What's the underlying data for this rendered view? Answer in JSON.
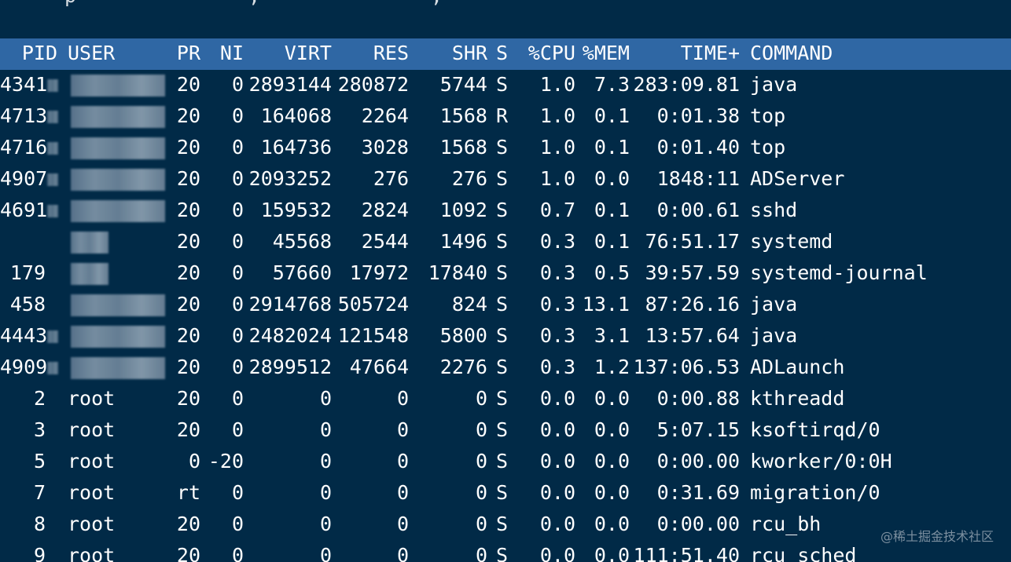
{
  "top_fragments": [
    {
      "text": "p"
    },
    {
      "text": ","
    },
    {
      "text": ","
    }
  ],
  "header": {
    "pid": "PID",
    "user": "USER",
    "pr": "PR",
    "ni": "NI",
    "virt": "VIRT",
    "res": "RES",
    "shr": "SHR",
    "s": "S",
    "cpu": "%CPU",
    "mem": "%MEM",
    "time": "TIME+",
    "command": "COMMAND"
  },
  "processes": [
    {
      "pid": "4341",
      "user": "",
      "pr": "20",
      "ni": "0",
      "virt": "2893144",
      "res": "280872",
      "shr": "5744",
      "s": "S",
      "cpu": "1.0",
      "mem": "7.3",
      "time": "283:09.81",
      "command": "java"
    },
    {
      "pid": "4713",
      "user": "",
      "pr": "20",
      "ni": "0",
      "virt": "164068",
      "res": "2264",
      "shr": "1568",
      "s": "R",
      "cpu": "1.0",
      "mem": "0.1",
      "time": "0:01.38",
      "command": "top"
    },
    {
      "pid": "4716",
      "user": "",
      "pr": "20",
      "ni": "0",
      "virt": "164736",
      "res": "3028",
      "shr": "1568",
      "s": "S",
      "cpu": "1.0",
      "mem": "0.1",
      "time": "0:01.40",
      "command": "top"
    },
    {
      "pid": "4907",
      "user": "",
      "pr": "20",
      "ni": "0",
      "virt": "2093252",
      "res": "276",
      "shr": "276",
      "s": "S",
      "cpu": "1.0",
      "mem": "0.0",
      "time": "1848:11",
      "command": "ADServer"
    },
    {
      "pid": "4691",
      "user": "",
      "pr": "20",
      "ni": "0",
      "virt": "159532",
      "res": "2824",
      "shr": "1092",
      "s": "S",
      "cpu": "0.7",
      "mem": "0.1",
      "time": "0:00.61",
      "command": "sshd"
    },
    {
      "pid": "",
      "user": "",
      "pr": "20",
      "ni": "0",
      "virt": "45568",
      "res": "2544",
      "shr": "1496",
      "s": "S",
      "cpu": "0.3",
      "mem": "0.1",
      "time": "76:51.17",
      "command": "systemd"
    },
    {
      "pid": "179",
      "user": "",
      "pr": "20",
      "ni": "0",
      "virt": "57660",
      "res": "17972",
      "shr": "17840",
      "s": "S",
      "cpu": "0.3",
      "mem": "0.5",
      "time": "39:57.59",
      "command": "systemd-journal"
    },
    {
      "pid": "458",
      "user": "",
      "pr": "20",
      "ni": "0",
      "virt": "2914768",
      "res": "505724",
      "shr": "824",
      "s": "S",
      "cpu": "0.3",
      "mem": "13.1",
      "time": "87:26.16",
      "command": "java"
    },
    {
      "pid": "4443",
      "user": "",
      "pr": "20",
      "ni": "0",
      "virt": "2482024",
      "res": "121548",
      "shr": "5800",
      "s": "S",
      "cpu": "0.3",
      "mem": "3.1",
      "time": "13:57.64",
      "command": "java"
    },
    {
      "pid": "4909",
      "user": "",
      "pr": "20",
      "ni": "0",
      "virt": "2899512",
      "res": "47664",
      "shr": "2276",
      "s": "S",
      "cpu": "0.3",
      "mem": "1.2",
      "time": "137:06.53",
      "command": "ADLaunch"
    },
    {
      "pid": "2",
      "user": "root",
      "pr": "20",
      "ni": "0",
      "virt": "0",
      "res": "0",
      "shr": "0",
      "s": "S",
      "cpu": "0.0",
      "mem": "0.0",
      "time": "0:00.88",
      "command": "kthreadd"
    },
    {
      "pid": "3",
      "user": "root",
      "pr": "20",
      "ni": "0",
      "virt": "0",
      "res": "0",
      "shr": "0",
      "s": "S",
      "cpu": "0.0",
      "mem": "0.0",
      "time": "5:07.15",
      "command": "ksoftirqd/0"
    },
    {
      "pid": "5",
      "user": "root",
      "pr": "0",
      "ni": "-20",
      "virt": "0",
      "res": "0",
      "shr": "0",
      "s": "S",
      "cpu": "0.0",
      "mem": "0.0",
      "time": "0:00.00",
      "command": "kworker/0:0H"
    },
    {
      "pid": "7",
      "user": "root",
      "pr": "rt",
      "ni": "0",
      "virt": "0",
      "res": "0",
      "shr": "0",
      "s": "S",
      "cpu": "0.0",
      "mem": "0.0",
      "time": "0:31.69",
      "command": "migration/0"
    },
    {
      "pid": "8",
      "user": "root",
      "pr": "20",
      "ni": "0",
      "virt": "0",
      "res": "0",
      "shr": "0",
      "s": "S",
      "cpu": "0.0",
      "mem": "0.0",
      "time": "0:00.00",
      "command": "rcu_bh"
    },
    {
      "pid": "9",
      "user": "root",
      "pr": "20",
      "ni": "0",
      "virt": "0",
      "res": "0",
      "shr": "0",
      "s": "S",
      "cpu": "0.0",
      "mem": "0.0",
      "time": "111:51.40",
      "command": "rcu_sched"
    }
  ],
  "watermark": "@稀土掘金技术社区",
  "colors": {
    "background": "#012a47",
    "header_bar": "#2f67a4",
    "text": "#ffffff"
  }
}
